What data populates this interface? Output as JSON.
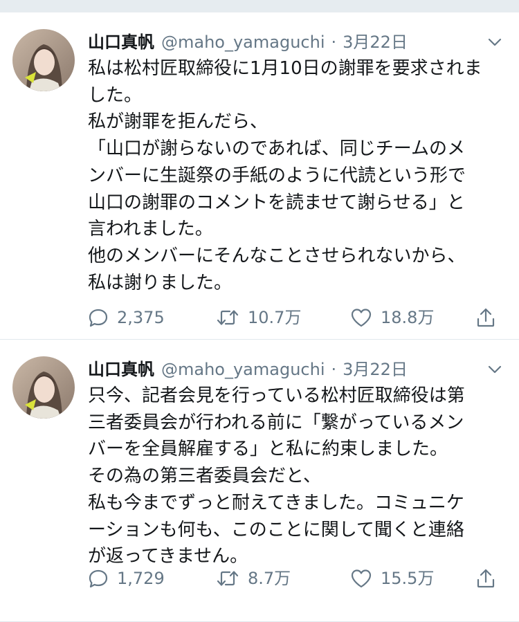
{
  "tweets": [
    {
      "author": {
        "display_name": "山口真帆",
        "handle": "@maho_yamaguchi",
        "separator": "·",
        "date": "3月22日"
      },
      "lines": [
        "私は松村匠取締役に1月10日の謝罪を要求されま",
        "した。",
        "私が謝罪を拒んだら、",
        "「山口が謝らないのであれば、同じチームのメ",
        "ンバーに生誕祭の手紙のように代読という形で",
        "山口の謝罪のコメントを読ませて謝らせる」と",
        "言われました。",
        "他のメンバーにそんなことさせられないから、",
        "私は謝りました。"
      ],
      "stats": {
        "replies": "2,375",
        "retweets": "10.7万",
        "likes": "18.8万"
      }
    },
    {
      "author": {
        "display_name": "山口真帆",
        "handle": "@maho_yamaguchi",
        "separator": "·",
        "date": "3月22日"
      },
      "lines": [
        "只今、記者会見を行っている松村匠取締役は第",
        "三者委員会が行われる前に「繋がっているメン",
        "バーを全員解雇する」と私に約束しました。",
        "その為の第三者委員会だと、",
        "私も今までずっと耐えてきました。コミュニケ",
        "ーションも何も、このことに関して聞くと連絡",
        "が返ってきません。"
      ],
      "stats": {
        "replies": "1,729",
        "retweets": "8.7万",
        "likes": "15.5万"
      }
    }
  ],
  "icons": {
    "reply": "reply-icon",
    "retweet": "retweet-icon",
    "like": "like-icon",
    "share": "share-icon",
    "menu": "chevron-down-icon"
  },
  "colors": {
    "text": "#14171a",
    "secondary": "#657786",
    "divider": "#e1e8ed",
    "top_strip": "#e6ecf0"
  }
}
